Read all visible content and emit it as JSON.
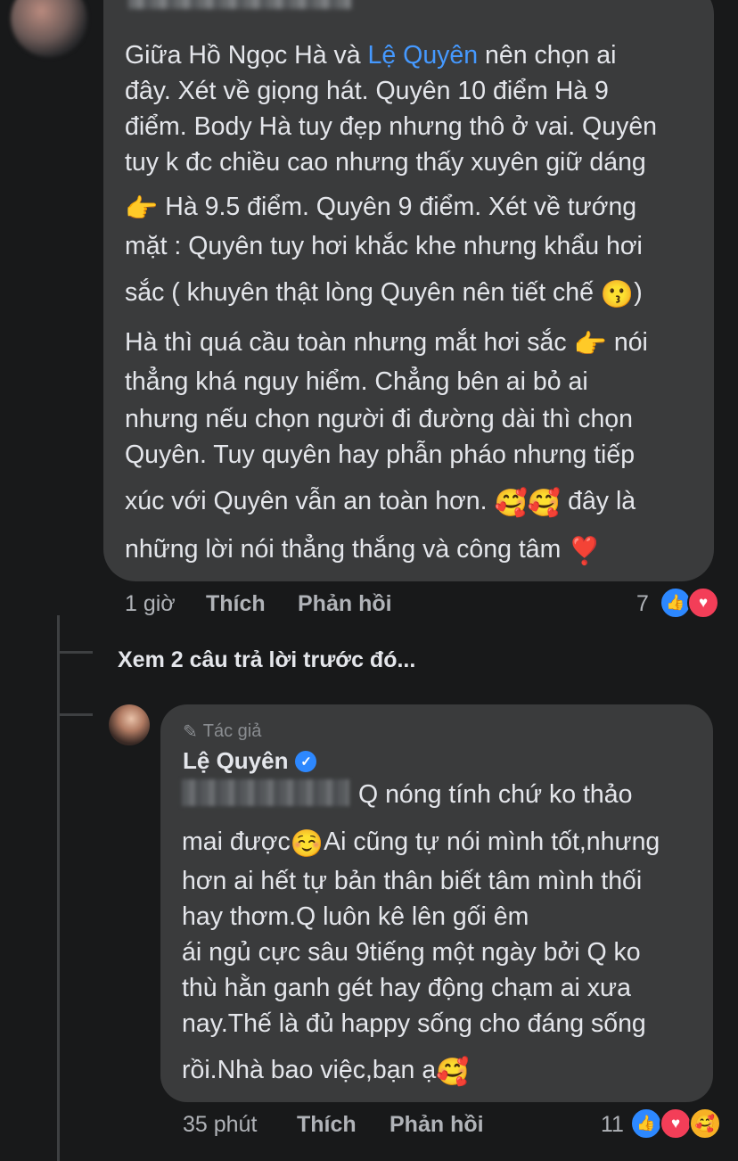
{
  "comment1": {
    "lines": [
      {
        "before": "Giữa Hồ Ngọc Hà  và ",
        "mention": "Lệ Quyên",
        "after": " nên chọn ai"
      },
      {
        "text": "đây. Xét về giọng hát. Quyên 10 điểm Hà 9"
      },
      {
        "text": "điểm. Body Hà tuy đẹp nhưng thô ở vai. Quyên"
      },
      {
        "text": "tuy k đc chiều cao nhưng thấy xuyên giữ dáng"
      },
      {
        "emoji": "👉",
        "text": " Hà 9.5 điểm. Quyên 9 điểm. Xét về tướng"
      },
      {
        "text": "mặt : Quyên tuy hơi khắc khe nhưng khẩu hơi"
      },
      {
        "text": "sắc ( khuyên thật lòng Quyên nên tiết chế ",
        "emoji": "😗",
        "after": ")"
      },
      {
        "text": "Hà thì quá cầu toàn nhưng mắt hơi sắc ",
        "emoji": "👉",
        "after": " nói"
      },
      {
        "text": "thẳng khá nguy hiểm. Chẳng bên ai bỏ ai"
      },
      {
        "text": "nhưng nếu chọn người đi đường dài thì chọn"
      },
      {
        "text": "Quyên. Tuy quyên hay phẫn pháo nhưng tiếp"
      },
      {
        "text": "xúc với Quyên  vẫn an toàn hơn. ",
        "emoji": "🥰🥰",
        "after": " đây là"
      },
      {
        "text": "những lời nói thẳng thắng và công tâm ",
        "emoji": "❣️"
      }
    ],
    "time": "1 giờ",
    "like_label": "Thích",
    "reply_label": "Phản hồi",
    "reaction_count": "7"
  },
  "see_more": "Xem 2 câu trả lời trước đó...",
  "comment2": {
    "badge": "Tác giả",
    "author": "Lệ Quyên",
    "lines": [
      {
        "text": "Q nóng tính chứ ko thảo"
      },
      {
        "text": "mai được",
        "emoji": "☺️",
        "after": "Ai cũng tự nói mình tốt,nhưng"
      },
      {
        "text": "hơn ai hết tự bản thân biết tâm mình thối"
      },
      {
        "text": "hay thơm.Q luôn kê lên gối êm"
      },
      {
        "text": "ái ngủ cực sâu 9tiếng một ngày bởi Q ko"
      },
      {
        "text": "thù hằn ganh gét hay động chạm ai xưa"
      },
      {
        "text": "nay.Thế là đủ happy sống cho đáng sống"
      },
      {
        "text": "rồi.Nhà bao việc,bạn ạ",
        "emoji": "🥰"
      }
    ],
    "time": "35 phút",
    "like_label": "Thích",
    "reply_label": "Phản hồi",
    "reaction_count": "11"
  },
  "icons": {
    "like": "👍",
    "love": "♥",
    "care": "🥰",
    "verified": "✓",
    "pen": "✎"
  }
}
